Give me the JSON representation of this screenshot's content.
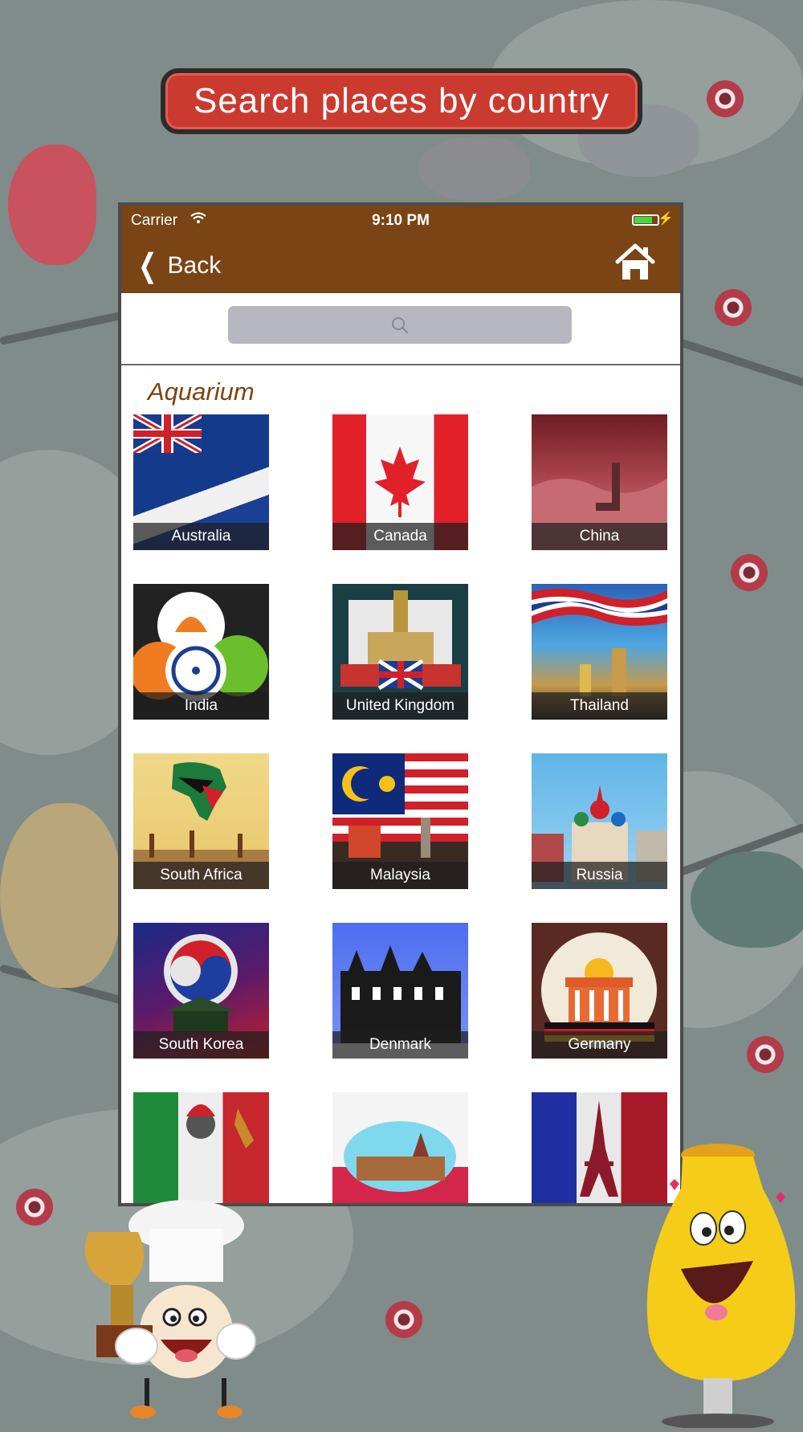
{
  "banner": {
    "text": "Search places by country"
  },
  "status_bar": {
    "carrier": "Carrier",
    "time": "9:10 PM"
  },
  "nav": {
    "back_label": "Back"
  },
  "search": {
    "placeholder": ""
  },
  "section": {
    "title": "Aquarium"
  },
  "countries": [
    {
      "name": "Australia"
    },
    {
      "name": "Canada"
    },
    {
      "name": "China"
    },
    {
      "name": "India"
    },
    {
      "name": "United Kingdom"
    },
    {
      "name": "Thailand"
    },
    {
      "name": "South Africa"
    },
    {
      "name": "Malaysia"
    },
    {
      "name": "Russia"
    },
    {
      "name": "South Korea"
    },
    {
      "name": "Denmark"
    },
    {
      "name": "Germany"
    },
    {
      "name": ""
    },
    {
      "name": ""
    },
    {
      "name": ""
    }
  ],
  "colors": {
    "nav": "#7a4414",
    "banner": "#cb3a2f",
    "accent_text": "#7a4414"
  }
}
